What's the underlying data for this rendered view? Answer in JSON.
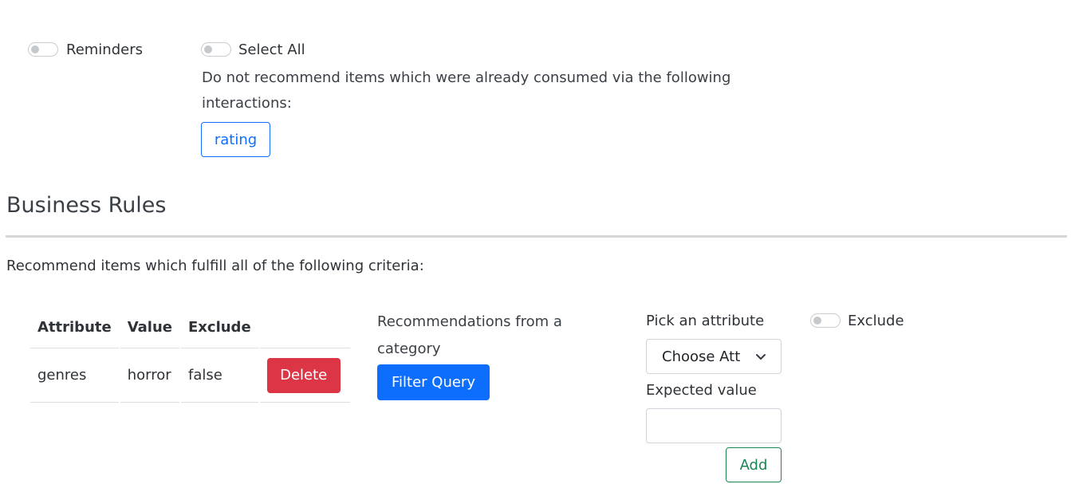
{
  "filters": {
    "reminders_label": "Reminders",
    "select_all_label": "Select All",
    "description": "Do not recommend items which were already consumed via the following interactions:",
    "interactions": [
      {
        "label": "rating"
      }
    ]
  },
  "business_rules": {
    "title": "Business Rules",
    "criteria_text": "Recommend items which fulfill all of the following criteria:",
    "table": {
      "headers": [
        "Attribute",
        "Value",
        "Exclude"
      ],
      "rows": [
        {
          "attribute": "genres",
          "value": "horror",
          "exclude": "false",
          "delete_label": "Delete"
        }
      ]
    },
    "category": {
      "label": "Recommendations from a category",
      "button_label": "Filter Query"
    },
    "attribute_picker": {
      "pick_label": "Pick an attribute",
      "select_value": "Choose Att",
      "expected_label": "Expected value",
      "expected_value": "",
      "add_label": "Add"
    },
    "exclude_label": "Exclude"
  }
}
